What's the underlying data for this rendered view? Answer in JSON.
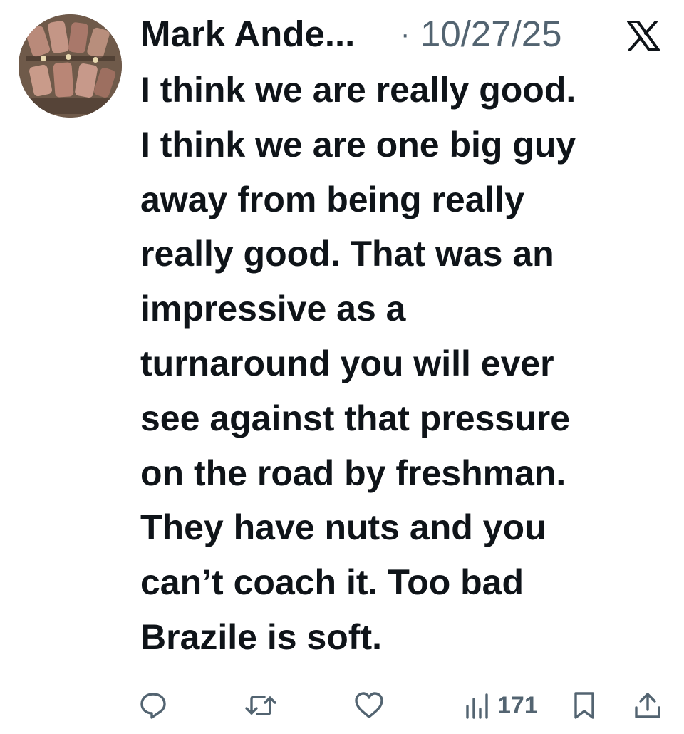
{
  "tweet": {
    "author_name": "Mark Ande...",
    "separator": "·",
    "date": "10/27/25",
    "platform_icon": "x-logo-icon",
    "text": "I think we are really good.\nI think we are one big guy\naway from being really\nreally good. That was an\nimpressive as a\nturnaround you will ever\nsee against that pressure\non the road by freshman.\nThey have nuts and you\ncan’t coach it. Too bad\nBrazile is soft."
  },
  "actions": {
    "reply_icon": "reply-icon",
    "retweet_icon": "retweet-icon",
    "like_icon": "like-icon",
    "views_icon": "views-icon",
    "view_count": "171",
    "bookmark_icon": "bookmark-icon",
    "share_icon": "share-icon"
  },
  "colors": {
    "text_primary": "#0f1419",
    "text_secondary": "#536471",
    "background": "#ffffff"
  }
}
